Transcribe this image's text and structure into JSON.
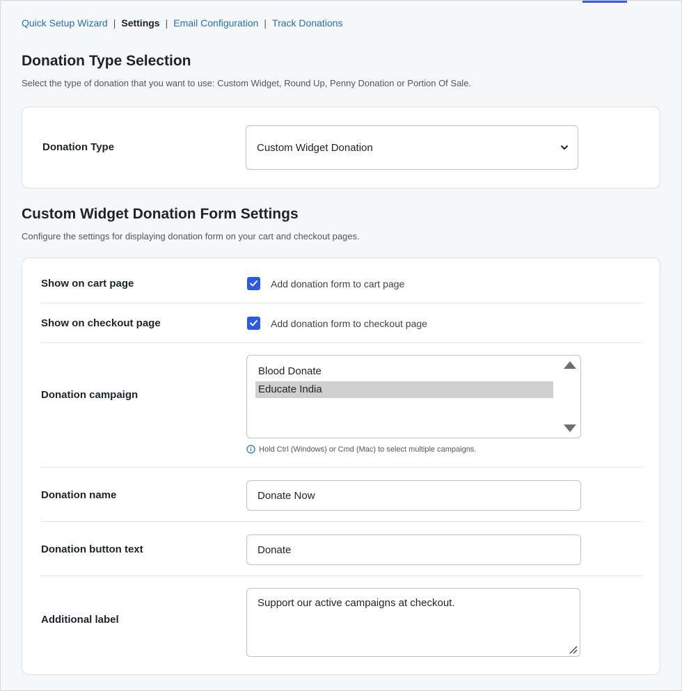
{
  "nav": {
    "items": [
      {
        "label": "Quick Setup Wizard"
      },
      {
        "label": "Settings"
      },
      {
        "label": "Email Configuration"
      },
      {
        "label": "Track Donations"
      }
    ],
    "separator": "|"
  },
  "donation_type_section": {
    "title": "Donation Type Selection",
    "description": "Select the type of donation that you want to use: Custom Widget, Round Up, Penny Donation or Portion Of Sale.",
    "field_label": "Donation Type",
    "selected_value": "Custom Widget Donation"
  },
  "form_settings_section": {
    "title": "Custom Widget Donation Form Settings",
    "description": "Configure the settings for displaying donation form on your cart and checkout pages.",
    "show_on_cart": {
      "label": "Show on cart page",
      "checkbox_label": "Add donation form to cart page",
      "checked": true
    },
    "show_on_checkout": {
      "label": "Show on checkout page",
      "checkbox_label": "Add donation form to checkout page",
      "checked": true
    },
    "campaign": {
      "label": "Donation campaign",
      "options": [
        {
          "label": "Blood Donate",
          "selected": false
        },
        {
          "label": "Educate India",
          "selected": true
        }
      ],
      "hint": "Hold Ctrl (Windows) or Cmd (Mac) to select multiple campaigns."
    },
    "donation_name": {
      "label": "Donation name",
      "value": "Donate Now"
    },
    "button_text": {
      "label": "Donation button text",
      "value": "Donate"
    },
    "additional_label": {
      "label": "Additional label",
      "value": "Support our active campaigns at checkout."
    }
  },
  "colors": {
    "accent": "#2c5be3",
    "link": "#2271b1"
  }
}
